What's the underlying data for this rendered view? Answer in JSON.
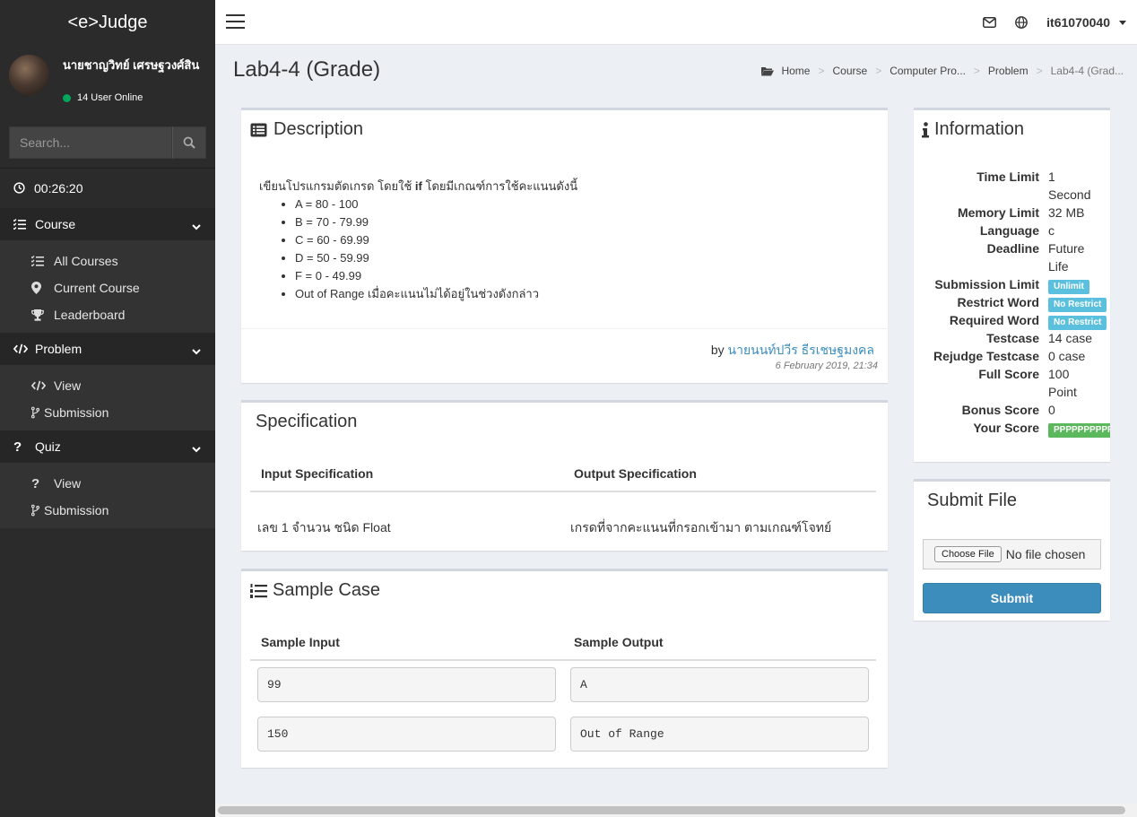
{
  "app": {
    "logo": "<e>Judge"
  },
  "user": {
    "name": "นายชาญวิทย์ เศรษฐวงศ์สิน",
    "online": "14 User Online"
  },
  "search": {
    "placeholder": "Search..."
  },
  "timer": "00:26:20",
  "menu": {
    "course": {
      "label": "Course",
      "items": [
        "All Courses",
        "Current Course",
        "Leaderboard"
      ]
    },
    "problem": {
      "label": "Problem",
      "items": [
        "View",
        "Submission"
      ]
    },
    "quiz": {
      "label": "Quiz",
      "items": [
        "View",
        "Submission"
      ]
    }
  },
  "topbar": {
    "username": "it61070040"
  },
  "page": {
    "title": "Lab4-4 (Grade)"
  },
  "breadcrumb": [
    "Home",
    "Course",
    "Computer Pro...",
    "Problem",
    "Lab4-4 (Grad..."
  ],
  "description": {
    "title": "Description",
    "intro_pre": "เขียนโปรแกรมตัดเกรด โดยใช้ ",
    "intro_kw": "if",
    "intro_post": " โดยมีเกณฑ์การใช้คะแนนดังนี้",
    "items": [
      "A = 80 - 100",
      "B = 70 - 79.99",
      "C = 60 - 69.99",
      "D = 50 - 59.99",
      "F = 0 - 49.99",
      "Out of Range เมื่อคะแนนไม่ได้อยู่ในช่วงดังกล่าว"
    ],
    "by": "by",
    "author": "นายนนท์ปวีร ธีรเชษฐมงคล",
    "date": "6 February 2019, 21:34"
  },
  "specification": {
    "title": "Specification",
    "input_header": "Input Specification",
    "output_header": "Output Specification",
    "input": "เลข 1 จำนวน ชนิด Float",
    "output": "เกรดที่จากคะแนนที่กรอกเข้ามา ตามเกณฑ์โจทย์"
  },
  "sample": {
    "title": "Sample Case",
    "input_header": "Sample Input",
    "output_header": "Sample Output",
    "rows": [
      {
        "input": "99",
        "output": "A"
      },
      {
        "input": "150",
        "output": "Out of Range"
      }
    ]
  },
  "information": {
    "title": "Information",
    "time_limit": {
      "k": "Time Limit",
      "v1": "1",
      "v2": "Second"
    },
    "memory_limit": {
      "k": "Memory Limit",
      "v": "32 MB"
    },
    "language": {
      "k": "Language",
      "v": "c"
    },
    "deadline": {
      "k": "Deadline",
      "v1": "Future",
      "v2": "Life"
    },
    "submission_limit": {
      "k": "Submission Limit",
      "v": "Unlimit"
    },
    "restrict_word": {
      "k": "Restrict Word",
      "v": "No Restrict"
    },
    "required_word": {
      "k": "Required Word",
      "v": "No Restrict"
    },
    "testcase": {
      "k": "Testcase",
      "v": "14 case"
    },
    "rejudge": {
      "k": "Rejudge Testcase",
      "v": "0 case"
    },
    "full_score": {
      "k": "Full Score",
      "v1": "100",
      "v2": "Point"
    },
    "bonus_score": {
      "k": "Bonus Score",
      "v": "0"
    },
    "your_score": {
      "k": "Your Score",
      "v": "PPPPPPPPPPPPPP"
    }
  },
  "submit": {
    "title": "Submit File",
    "choose": "Choose File",
    "no_file": "No file chosen",
    "button": "Submit"
  },
  "colors": {
    "sidebar": "#2b2b2b",
    "accent": "#3c8dbc",
    "info_label": "#5bc0de",
    "success_label": "#5cb85c"
  }
}
